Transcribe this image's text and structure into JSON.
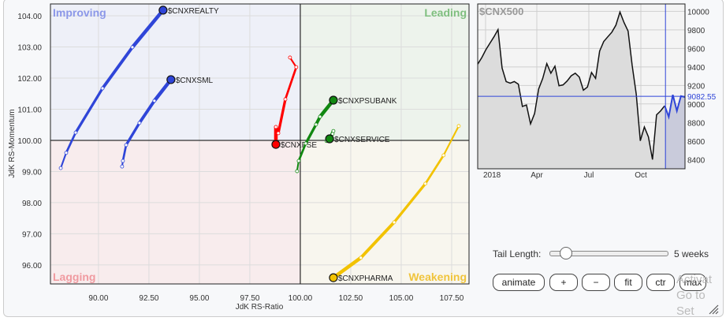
{
  "chart_data": [
    {
      "type": "scatter",
      "subtype": "relative-rotation-graph",
      "xlabel": "JdK RS-Ratio",
      "ylabel": "JdK RS-Momentum",
      "xlim": [
        87.62,
        108.36
      ],
      "ylim": [
        95.39,
        104.38
      ],
      "xticks": [
        "90.00",
        "92.50",
        "95.00",
        "97.50",
        "100.00",
        "102.50",
        "105.00",
        "107.50"
      ],
      "yticks": [
        "96.00",
        "97.00",
        "98.00",
        "99.00",
        "100.00",
        "101.00",
        "102.00",
        "103.00",
        "104.00"
      ],
      "grid": true,
      "quadrants": [
        {
          "name": "Improving",
          "color": "#eef0f8",
          "label_color": "#8b97e8"
        },
        {
          "name": "Leading",
          "color": "#edf3ec",
          "label_color": "#7fbf7f"
        },
        {
          "name": "Lagging",
          "color": "#f8eced",
          "label_color": "#f09aa0"
        },
        {
          "name": "Weakening",
          "color": "#f8f6ee",
          "label_color": "#f0c43c"
        }
      ],
      "series": [
        {
          "name": "$CNXREALTY",
          "color": "#2f45d8",
          "tail": [
            [
              88.13,
              99.11
            ],
            [
              88.4,
              99.6
            ],
            [
              88.87,
              100.25
            ],
            [
              90.2,
              101.67
            ],
            [
              91.68,
              102.99
            ],
            [
              93.2,
              104.18
            ]
          ]
        },
        {
          "name": "$CNXSML",
          "color": "#2f45d8",
          "tail": [
            [
              91.17,
              99.16
            ],
            [
              91.21,
              99.34
            ],
            [
              91.37,
              99.85
            ],
            [
              92.03,
              100.56
            ],
            [
              92.77,
              101.27
            ],
            [
              93.59,
              101.95
            ]
          ]
        },
        {
          "name": "$CNXFSE",
          "color": "#ff0000",
          "tail": [
            [
              99.49,
              102.66
            ],
            [
              99.8,
              102.35
            ],
            [
              99.26,
              101.32
            ],
            [
              98.91,
              100.23
            ],
            [
              98.79,
              100.43
            ],
            [
              98.79,
              99.87
            ]
          ]
        },
        {
          "name": "$CNXPSUBANK",
          "color": "#118811",
          "tail": [
            [
              99.84,
              99.01
            ],
            [
              99.92,
              99.34
            ],
            [
              100.27,
              99.9
            ],
            [
              100.78,
              100.51
            ],
            [
              100.98,
              100.76
            ],
            [
              101.64,
              101.29
            ]
          ]
        },
        {
          "name": "$CNXSERVICE",
          "color": "#118811",
          "tail": [
            [
              101.3,
              99.98
            ],
            [
              101.52,
              100.12
            ],
            [
              101.6,
              100.21
            ],
            [
              101.64,
              100.3
            ],
            [
              101.45,
              100.05
            ]
          ]
        },
        {
          "name": "$CNXPHARMA",
          "color": "#f2c200",
          "tail": [
            [
              107.85,
              100.46
            ],
            [
              107.1,
              99.52
            ],
            [
              106.2,
              98.61
            ],
            [
              104.65,
              97.37
            ],
            [
              103.0,
              96.23
            ],
            [
              101.64,
              95.59
            ]
          ]
        }
      ]
    },
    {
      "type": "area",
      "title": "$CNX500",
      "ylim": [
        8300,
        10080
      ],
      "yticks": [
        "8400",
        "8600",
        "8800",
        "9000",
        "9200",
        "9400",
        "9600",
        "9800",
        "10000"
      ],
      "xticks": [
        "2018",
        "Apr",
        "Jul",
        "Oct"
      ],
      "current_value": "9082.55",
      "current_value_num": 9082.55,
      "grid": true,
      "values": [
        9430,
        9500,
        9585,
        9655,
        9725,
        9803,
        9388,
        9242,
        9225,
        9242,
        9214,
        8973,
        8989,
        8785,
        8897,
        9163,
        9276,
        9436,
        9332,
        9408,
        9197,
        9206,
        9248,
        9304,
        9332,
        9290,
        9149,
        9183,
        9340,
        9276,
        9571,
        9674,
        9725,
        9775,
        9851,
        9992,
        9879,
        9787,
        9416,
        9107,
        8602,
        8751,
        8644,
        8400,
        8883,
        8925,
        8981
      ],
      "highlight_values": [
        8981,
        8860,
        9099,
        8925,
        9085,
        9074
      ],
      "line_color": "#111111",
      "highlight_color": "#2f45d8"
    }
  ],
  "controls": {
    "tail_label": "Tail Length:",
    "tail_value": "5 weeks",
    "tail_fraction": 0.13,
    "buttons": [
      "animate",
      "+",
      "−",
      "fit",
      "ctr",
      "max"
    ]
  },
  "watermark": [
    "Activat",
    "Go to Set"
  ]
}
